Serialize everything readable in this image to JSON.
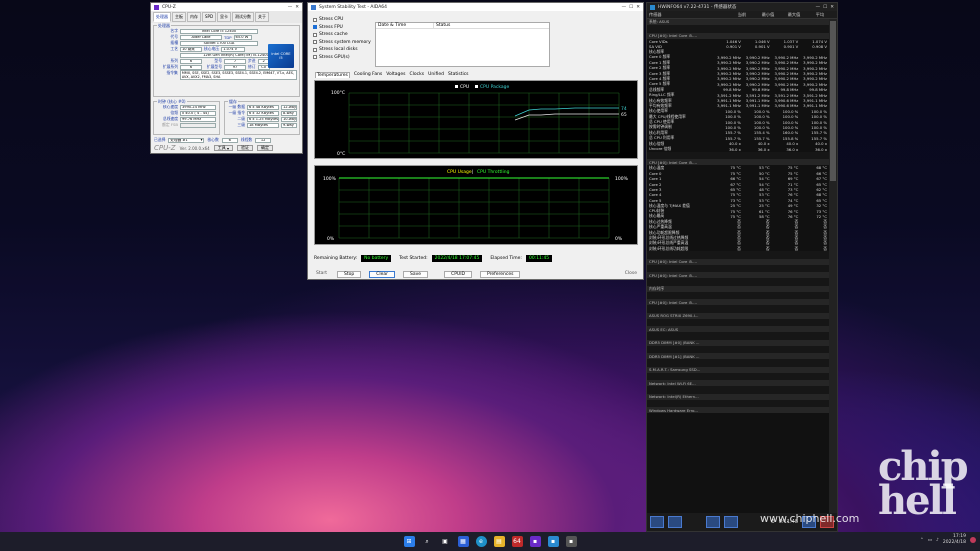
{
  "cpuz": {
    "title": "CPU-Z",
    "tabs": [
      "处理器",
      "主板",
      "内存",
      "SPD",
      "显卡",
      "测试分数",
      "关于"
    ],
    "group_proc": "处理器",
    "rows": [
      {
        "l": "名字",
        "v": "Intel Core i5 12400"
      },
      {
        "l": "代号",
        "v": "Alder Lake",
        "l2": "TDP",
        "v2": "65.0 W"
      },
      {
        "l": "插槽",
        "v": "Socket 1700 LGA"
      },
      {
        "l": "工艺",
        "v": "10 纳米",
        "l2": "核心电压",
        "v2": "1.074 V"
      },
      {
        "l": "",
        "v": "12th Gen Intel(R) Core(TM) i5-12400"
      },
      {
        "l": "系列",
        "v": "6",
        "l2": "型号",
        "v2": "7",
        "l3": "步进",
        "v3": "2"
      },
      {
        "l": "扩展系列",
        "v": "6",
        "l2": "扩展型号",
        "v2": "97",
        "l3": "修订",
        "v3": "C0"
      }
    ],
    "instr_label": "指令集",
    "instr": "MMX, SSE, SSE2, SSE3, SSSE3, SSE4.1, SSE4.2, EM64T, VT-x, AES, AVX, AVX2, FMA3, SHA",
    "intel_logo": "intel CORE i5",
    "clock_group": "时钟 (核心 #0)",
    "clocks": [
      {
        "l": "核心速度",
        "v": "3990.24 MHz"
      },
      {
        "l": "倍频",
        "v": "x 40.0 ( 4 - 44)"
      },
      {
        "l": "总线速度",
        "v": "99.76 MHz"
      },
      {
        "l": "额定 FSB",
        "v": ""
      }
    ],
    "cache_group": "缓存",
    "caches": [
      {
        "l": "一级 数据",
        "v": "6 x 48 KBytes",
        "w": "12-way"
      },
      {
        "l": "一级 指令",
        "v": "6 x 32 KBytes",
        "w": "8-way"
      },
      {
        "l": "二级",
        "v": "6 x 1.25 MBytes",
        "w": "10-way"
      },
      {
        "l": "三级",
        "v": "18 MBytes",
        "w": "9-way"
      }
    ],
    "sel_label": "已选择",
    "sel_value": "处理器 #1",
    "cores_label": "核心数",
    "cores": "6",
    "threads_label": "线程数",
    "threads": "12",
    "brand": "CPU-Z",
    "version": "Ver. 2.00.0.x64",
    "tools": "工具",
    "validate": "验证",
    "ok": "确定"
  },
  "aida": {
    "title": "System Stability Test - AIDA64",
    "stress": [
      {
        "t": "Stress CPU",
        "on": false
      },
      {
        "t": "Stress FPU",
        "on": true
      },
      {
        "t": "Stress cache",
        "on": false
      },
      {
        "t": "Stress system memory",
        "on": false
      },
      {
        "t": "Stress local disks",
        "on": false
      },
      {
        "t": "Stress GPU(s)",
        "on": false
      }
    ],
    "col_date": "Date & Time",
    "col_status": "Status",
    "tabs": [
      "Temperatures",
      "Cooling Fans",
      "Voltages",
      "Clocks",
      "Unified",
      "Statistics"
    ],
    "temp_legend": [
      "CPU",
      "CPU Package"
    ],
    "temp_top": "100°C",
    "temp_bot": "0°C",
    "temp_vals": [
      "74",
      "65"
    ],
    "usage_title": "CPU Usage",
    "usage_sep": "|",
    "usage_throttle": "CPU Throttling",
    "usage_top": "100%",
    "usage_bot": "0%",
    "usage_right_top": "100%",
    "usage_right_bot": "0%",
    "battery_label": "Remaining Battery:",
    "battery": "No battery",
    "started_label": "Test Started:",
    "started": "2022/4/18 17:07:45",
    "elapsed_label": "Elapsed Time:",
    "elapsed": "00:11:45",
    "buttons": [
      "Start",
      "Stop",
      "Clear",
      "Save",
      "CPUID",
      "Preferences",
      "Close"
    ]
  },
  "hw": {
    "title": "HWiNFO64 v7.22-4731 - 传感器状态",
    "cols": [
      "传感器",
      "当前",
      "最小值",
      "最大值",
      "平均"
    ],
    "rows": [
      {
        "t": "sec",
        "n": "系统: ASUS"
      },
      {
        "t": "gap"
      },
      {
        "t": "sec",
        "n": "CPU [#0]: Intel Core i5-..."
      },
      {
        "n": "Core VIDs",
        "v": [
          "1.046 V",
          "1.046 V",
          "1.037 V",
          "1.074 V",
          "1.046 V"
        ]
      },
      {
        "n": "SA VID",
        "v": [
          "0.901 V",
          "0.901 V",
          "0.901 V",
          "0.908 V",
          "0.901 V"
        ]
      },
      {
        "n": "核心频率",
        "v": [
          "",
          "",
          "",
          "",
          ""
        ]
      },
      {
        "n": "Core 0 频率",
        "v": [
          "3,990.2 MHz",
          "3,990.2 MHz",
          "3,990.2 MHz",
          "3,990.2 MHz"
        ]
      },
      {
        "n": "Core 1 频率",
        "v": [
          "3,990.2 MHz",
          "3,990.2 MHz",
          "3,990.2 MHz",
          "3,990.2 MHz"
        ]
      },
      {
        "n": "Core 2 频率",
        "v": [
          "3,990.2 MHz",
          "3,990.2 MHz",
          "3,990.2 MHz",
          "3,990.2 MHz"
        ]
      },
      {
        "n": "Core 3 频率",
        "v": [
          "3,990.2 MHz",
          "3,990.2 MHz",
          "3,990.2 MHz",
          "3,990.2 MHz"
        ]
      },
      {
        "n": "Core 4 频率",
        "v": [
          "3,990.2 MHz",
          "3,990.2 MHz",
          "3,990.2 MHz",
          "3,990.2 MHz"
        ]
      },
      {
        "n": "Core 5 频率",
        "v": [
          "3,990.2 MHz",
          "3,990.2 MHz",
          "3,990.2 MHz",
          "3,990.2 MHz"
        ]
      },
      {
        "n": "总线频率",
        "v": [
          "99.8 MHz",
          "99.8 MHz",
          "99.8 MHz",
          "99.8 MHz"
        ]
      },
      {
        "n": "Ring/LLC 频率",
        "v": [
          "3,591.2 MHz",
          "3,591.2 MHz",
          "3,591.2 MHz",
          "3,591.2 MHz"
        ]
      },
      {
        "n": "核心有效频率",
        "v": [
          "3,991.1 MHz",
          "3,991.1 MHz",
          "3,990.6 MHz",
          "3,991.1 MHz"
        ]
      },
      {
        "n": "平均有效频率",
        "v": [
          "3,991.1 MHz",
          "3,991.1 MHz",
          "3,990.6 MHz",
          "3,991.1 MHz"
        ]
      },
      {
        "n": "核心使用率",
        "v": [
          "100.0 %",
          "100.0 %",
          "100.0 %",
          "100.0 %"
        ]
      },
      {
        "n": "最大 CPU/线程使用率",
        "v": [
          "100.0 %",
          "100.0 %",
          "100.0 %",
          "100.0 %"
        ]
      },
      {
        "n": "总 CPU 使用率",
        "v": [
          "100.0 %",
          "100.0 %",
          "100.0 %",
          "100.0 %"
        ]
      },
      {
        "n": "按需时钟调制",
        "v": [
          "100.0 %",
          "100.0 %",
          "100.0 %",
          "100.0 %"
        ]
      },
      {
        "n": "核心利用率",
        "v": [
          "155.7 %",
          "155.4 %",
          "160.0 %",
          "155.7 %"
        ]
      },
      {
        "n": "总 CPU 利用率",
        "v": [
          "155.7 %",
          "155.7 %",
          "155.8 %",
          "155.7 %"
        ]
      },
      {
        "n": "核心倍频",
        "v": [
          "40.0 x",
          "40.0 x",
          "40.0 x",
          "40.0 x"
        ]
      },
      {
        "n": "Uncore 倍频",
        "v": [
          "36.0 x",
          "36.0 x",
          "36.0 x",
          "36.0 x"
        ]
      },
      {
        "t": "gap"
      },
      {
        "t": "sec",
        "n": "CPU [#0]: Intel Core i5-..."
      },
      {
        "n": "核心温度",
        "v": [
          "75 °C",
          "53 °C",
          "75 °C",
          "68 °C"
        ]
      },
      {
        "n": "Core 0",
        "v": [
          "75 °C",
          "50 °C",
          "75 °C",
          "66 °C"
        ]
      },
      {
        "n": "Core 1",
        "v": [
          "66 °C",
          "54 °C",
          "69 °C",
          "67 °C"
        ]
      },
      {
        "n": "Core 2",
        "v": [
          "67 °C",
          "54 °C",
          "71 °C",
          "65 °C"
        ]
      },
      {
        "n": "Core 3",
        "v": [
          "65 °C",
          "48 °C",
          "73 °C",
          "62 °C"
        ]
      },
      {
        "n": "Core 4",
        "v": [
          "75 °C",
          "53 °C",
          "76 °C",
          "68 °C"
        ]
      },
      {
        "n": "Core 5",
        "v": [
          "73 °C",
          "53 °C",
          "74 °C",
          "65 °C"
        ]
      },
      {
        "n": "核心温度与 TjMAX 差值",
        "v": [
          "25 °C",
          "25 °C",
          "49 °C",
          "32 °C"
        ]
      },
      {
        "n": "CPU封装",
        "v": [
          "75 °C",
          "61 °C",
          "76 °C",
          "73 °C"
        ]
      },
      {
        "n": "核心最高",
        "v": [
          "75 °C",
          "58 °C",
          "76 °C",
          "72 °C"
        ]
      },
      {
        "n": "核心过热降频",
        "v": [
          "否",
          "否",
          "否",
          "否"
        ]
      },
      {
        "n": "核心严重高温",
        "v": [
          "否",
          "否",
          "否",
          "否"
        ]
      },
      {
        "n": "核心功耗超限降频",
        "v": [
          "否",
          "否",
          "否",
          "否"
        ]
      },
      {
        "n": "封装/环形总线过热降频",
        "v": [
          "否",
          "否",
          "否",
          "否"
        ]
      },
      {
        "n": "封装/环形总线严重高温",
        "v": [
          "否",
          "否",
          "否",
          "否"
        ]
      },
      {
        "n": "封装/环形总线功耗超限",
        "v": [
          "否",
          "否",
          "否",
          "否"
        ]
      },
      {
        "t": "gap"
      },
      {
        "t": "sec",
        "n": "CPU [#0]: Intel Core i5-..."
      },
      {
        "t": "gap"
      },
      {
        "t": "sec",
        "n": "CPU [#0]: Intel Core i5-..."
      },
      {
        "t": "gap"
      },
      {
        "t": "sec",
        "n": "内存时序"
      },
      {
        "t": "gap"
      },
      {
        "t": "sec",
        "n": "CPU [#0]: Intel Core i5-..."
      },
      {
        "t": "gap"
      },
      {
        "t": "sec",
        "n": "ASUS ROG STRIX Z690-I..."
      },
      {
        "t": "gap"
      },
      {
        "t": "sec",
        "n": "ASUS EC: ASUS"
      },
      {
        "t": "gap"
      },
      {
        "t": "sec",
        "n": "DDR5 DIMM [#0] (BANK ..."
      },
      {
        "t": "gap"
      },
      {
        "t": "sec",
        "n": "DDR5 DIMM [#1] (BANK ..."
      },
      {
        "t": "gap"
      },
      {
        "t": "sec",
        "n": "S.M.A.R.T.: Samsung SSD..."
      },
      {
        "t": "gap"
      },
      {
        "t": "sec",
        "n": "Network: Intel Wi-Fi 6E..."
      },
      {
        "t": "gap"
      },
      {
        "t": "sec",
        "n": "Network: Intel(R) Ethern..."
      },
      {
        "t": "gap"
      },
      {
        "t": "sec",
        "n": "Windows Hardware Erro..."
      }
    ],
    "foot_time": "0:11:48"
  },
  "watermark": {
    "logo": "chip\nhell",
    "url": "www.chiphell.com"
  },
  "taskbar": {
    "time": "17:19",
    "date": "2022/4/18",
    "badge": "64"
  }
}
